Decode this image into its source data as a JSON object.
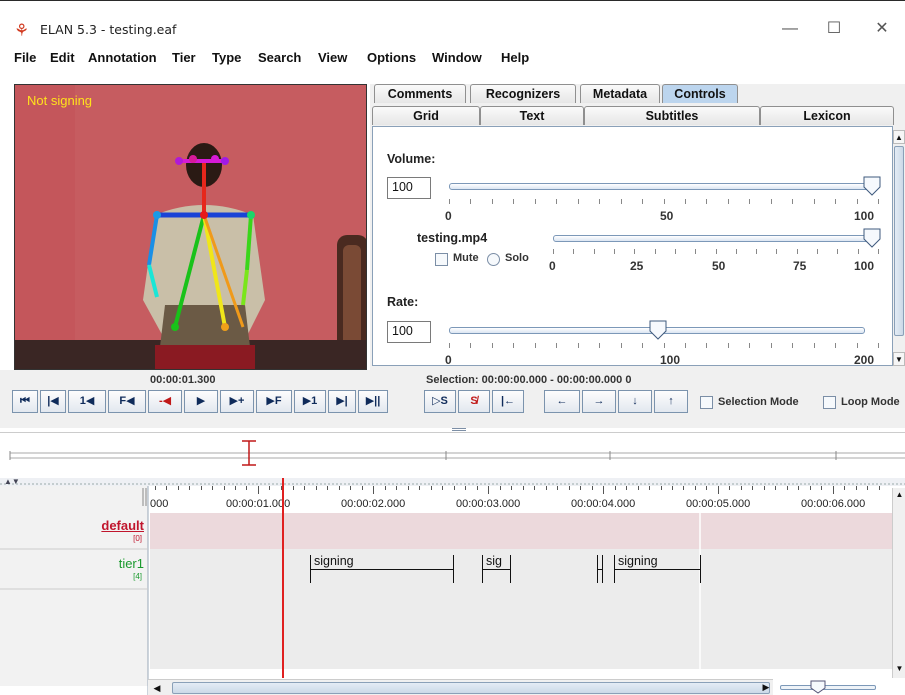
{
  "window": {
    "title": "ELAN 5.3 - testing.eaf",
    "minimize": "—",
    "maximize": "☐",
    "close": "✕"
  },
  "menu": [
    "File",
    "Edit",
    "Annotation",
    "Tier",
    "Type",
    "Search",
    "View",
    "Options",
    "Window",
    "Help"
  ],
  "video": {
    "overlay_label": "Not signing",
    "time": "00:00:01.300"
  },
  "tabs": {
    "row1": [
      "Comments",
      "Recognizers",
      "Metadata",
      "Controls"
    ],
    "row2": [
      "Grid",
      "Text",
      "Subtitles",
      "Lexicon"
    ],
    "active": "Controls"
  },
  "controls": {
    "volume_label": "Volume:",
    "volume_value": "100",
    "volume_fraction": 1.0,
    "volume_ticks": [
      "0",
      "50",
      "100"
    ],
    "media_file": "testing.mp4",
    "media_fraction": 1.0,
    "mute_label": "Mute",
    "solo_label": "Solo",
    "media_ticks": [
      "0",
      "25",
      "50",
      "75",
      "100"
    ],
    "rate_label": "Rate:",
    "rate_value": "100",
    "rate_fraction": 0.5,
    "rate_ticks": [
      "0",
      "100",
      "200"
    ]
  },
  "selection": {
    "text": "Selection: 00:00:00.000 - 00:00:00.000  0",
    "selection_mode": "Selection Mode",
    "loop_mode": "Loop Mode"
  },
  "transport": [
    "⏮",
    "|◀",
    "1◀",
    "F◀",
    "-◀",
    "▶",
    "▶+",
    "▶F",
    "▶1",
    "▶|",
    "▶||"
  ],
  "selection_buttons": [
    "▷S",
    "S̸",
    "|←",
    "←",
    "→",
    "↓",
    "↑"
  ],
  "timeline": {
    "ticks": [
      "000",
      "00:00:01.000",
      "00:00:02.000",
      "00:00:03.000",
      "00:00:04.000",
      "00:00:05.000",
      "00:00:06.000"
    ]
  },
  "tiers": [
    {
      "name": "default",
      "count": "[0]",
      "color": "#c0152c"
    },
    {
      "name": "tier1",
      "count": "[4]",
      "color": "#1a9a2e"
    }
  ],
  "annotations": [
    {
      "label": "signing",
      "start": 1.45,
      "end": 2.7
    },
    {
      "label": "sig",
      "start": 2.95,
      "end": 3.2
    },
    {
      "label": "",
      "start": 3.95,
      "end": 4.0
    },
    {
      "label": "signing",
      "start": 4.1,
      "end": 4.85
    }
  ]
}
